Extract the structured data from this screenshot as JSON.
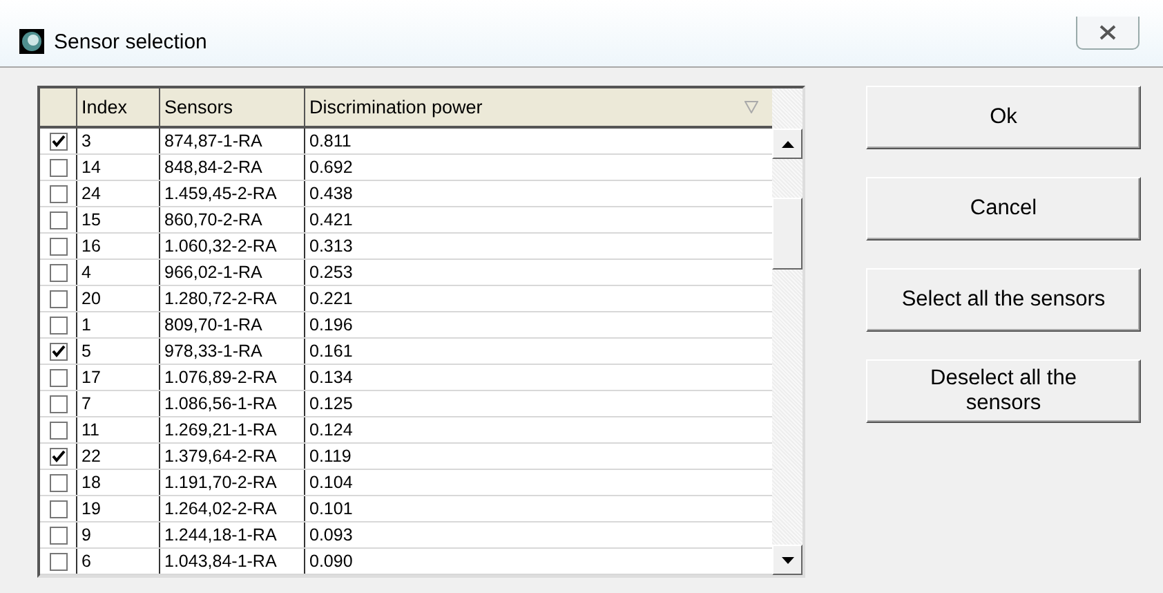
{
  "window": {
    "title": "Sensor selection"
  },
  "table": {
    "columns": [
      "Index",
      "Sensors",
      "Discrimination power"
    ],
    "rows": [
      {
        "checked": true,
        "index": "3",
        "sensor": "874,87-1-RA",
        "power": "0.811"
      },
      {
        "checked": false,
        "index": "14",
        "sensor": "848,84-2-RA",
        "power": "0.692"
      },
      {
        "checked": false,
        "index": "24",
        "sensor": "1.459,45-2-RA",
        "power": "0.438"
      },
      {
        "checked": false,
        "index": "15",
        "sensor": "860,70-2-RA",
        "power": "0.421"
      },
      {
        "checked": false,
        "index": "16",
        "sensor": "1.060,32-2-RA",
        "power": "0.313"
      },
      {
        "checked": false,
        "index": "4",
        "sensor": "966,02-1-RA",
        "power": "0.253"
      },
      {
        "checked": false,
        "index": "20",
        "sensor": "1.280,72-2-RA",
        "power": "0.221"
      },
      {
        "checked": false,
        "index": "1",
        "sensor": "809,70-1-RA",
        "power": "0.196"
      },
      {
        "checked": true,
        "index": "5",
        "sensor": "978,33-1-RA",
        "power": "0.161"
      },
      {
        "checked": false,
        "index": "17",
        "sensor": "1.076,89-2-RA",
        "power": "0.134"
      },
      {
        "checked": false,
        "index": "7",
        "sensor": "1.086,56-1-RA",
        "power": "0.125"
      },
      {
        "checked": false,
        "index": "11",
        "sensor": "1.269,21-1-RA",
        "power": "0.124"
      },
      {
        "checked": true,
        "index": "22",
        "sensor": "1.379,64-2-RA",
        "power": "0.119"
      },
      {
        "checked": false,
        "index": "18",
        "sensor": "1.191,70-2-RA",
        "power": "0.104"
      },
      {
        "checked": false,
        "index": "19",
        "sensor": "1.264,02-2-RA",
        "power": "0.101"
      },
      {
        "checked": false,
        "index": "9",
        "sensor": "1.244,18-1-RA",
        "power": "0.093"
      },
      {
        "checked": false,
        "index": "6",
        "sensor": "1.043,84-1-RA",
        "power": "0.090"
      }
    ]
  },
  "buttons": [
    "Ok",
    "Cancel",
    "Select all the sensors",
    "Deselect all the sensors"
  ]
}
